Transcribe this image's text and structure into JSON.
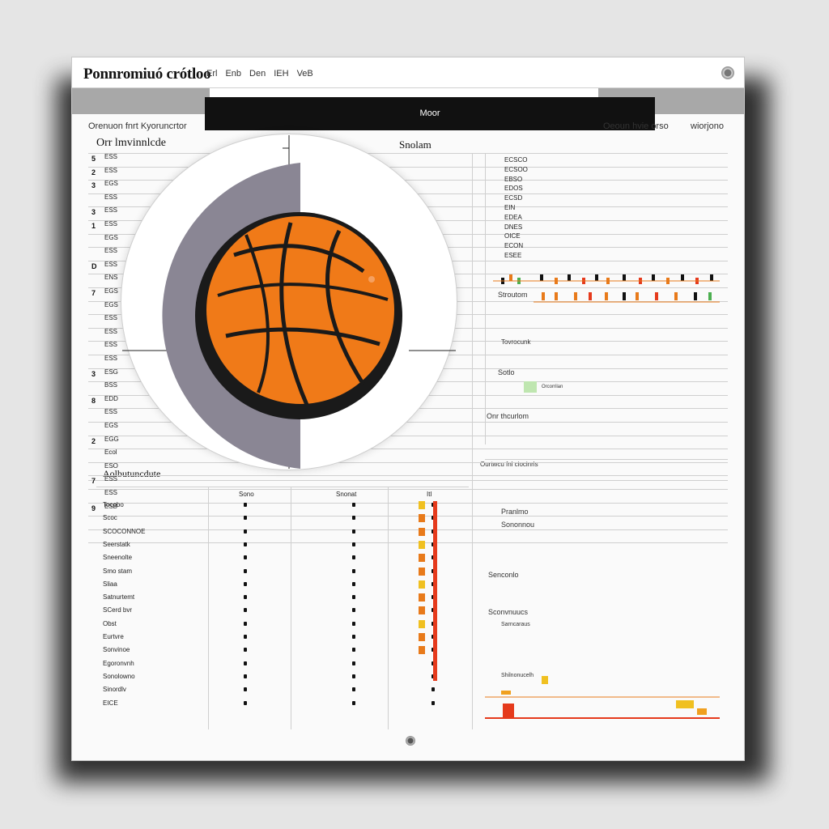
{
  "window": {
    "title": "Ponnromiuó crótloo",
    "menu": [
      "Erl",
      "Enb",
      "Den",
      "IEH",
      "VeB"
    ]
  },
  "toolbar": {
    "tab_label": "Moor",
    "left_label": "Orenuon  fnrt  Kyoruncrtor",
    "right_label": "Oeoun  hvie  orso",
    "right_label2": "wiorjono"
  },
  "sections": {
    "left_title": "Orr lmvinnlcde",
    "center_title": "Snolam",
    "lower_left_title": "Aolbutuncdute",
    "right_header": "Ourtwcu fnl  ciocinrls"
  },
  "left_rows": [
    "ESS",
    "ESS",
    "EGS",
    "ESS",
    "ESS",
    "ESS",
    "EGS",
    "ESS",
    "ESS",
    "ENS",
    "EGS",
    "EGS",
    "ESS",
    "ESS",
    "ESS",
    "ESS",
    "ESG",
    "BSS",
    "EDD",
    "ESS",
    "EGS",
    "EGG",
    "Ecol",
    "ESO",
    "ESS",
    "ESS",
    "ESB"
  ],
  "left_marks": [
    "5",
    "2",
    "3",
    "",
    "3",
    "1",
    "",
    "",
    "D",
    "",
    "7",
    "",
    "",
    "",
    "",
    "",
    "3",
    "",
    "8",
    "",
    "",
    "2",
    "",
    "",
    "7",
    "",
    "9"
  ],
  "right_rows": [
    "ECSCO",
    "ECSOO",
    "EBSO",
    "EDOS",
    "ECSD",
    "EIN",
    "EDEA",
    "DNES",
    "OICE",
    "ECON",
    "ESEE"
  ],
  "right_notes": {
    "legend_a": "Stroutom",
    "legend_b": "Tovrocunk",
    "legend_c": "Sotlo",
    "legend_d": "Orcorrilan",
    "legend_e": "Onr thcurlom"
  },
  "lower": {
    "columns": [
      "Sono",
      "Snonat",
      "Itl"
    ],
    "row_labels": [
      "Tocobo",
      "Scoc",
      "SCOCONNOE",
      "Seerstatk",
      "Sneenolte",
      "Smo stam",
      "Sliaa",
      "Satnurtemt",
      "SCerd  bvr",
      "Obst",
      "Eurtvre",
      "Sonvinoe",
      "Egoronvnh",
      "Sonolowno",
      "Sinordlv",
      "EICE"
    ],
    "right_labels": [
      "Pranlmo",
      "Sononnou",
      "Senconlo",
      "Sconvnuucs"
    ],
    "right_subnotes": [
      "Sarncaraus",
      "Shilnonucelh"
    ]
  },
  "colors": {
    "accent": "#e87a1a",
    "ball_dark": "#1a1a1a",
    "shadow_gray": "#8a8694",
    "bar_red": "#e53a1c",
    "bar_yellow": "#f0c020"
  },
  "icons": {
    "ball": "basketball-icon",
    "close": "window-control-icon",
    "knob": "scroll-knob-icon"
  }
}
